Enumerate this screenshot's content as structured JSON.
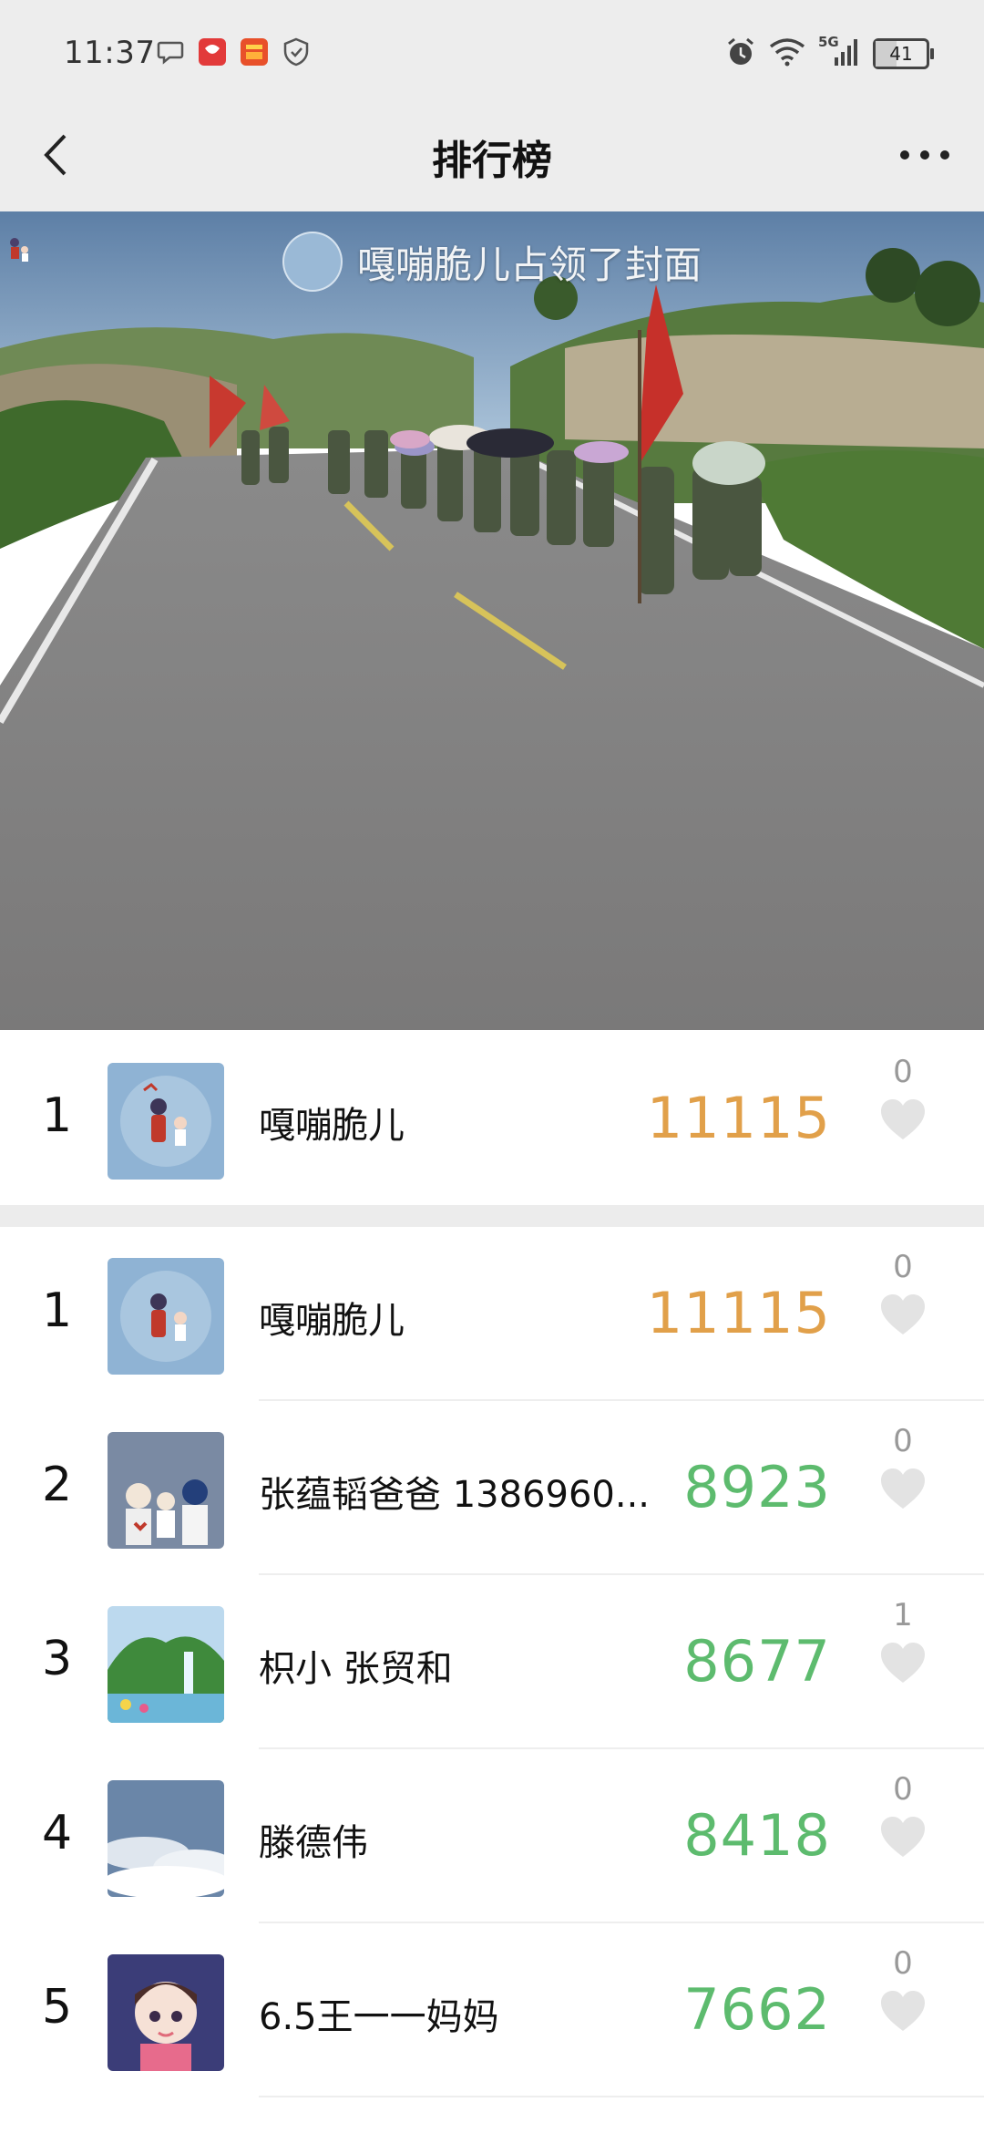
{
  "status_bar": {
    "time": "11:37",
    "battery": "41",
    "battery_level": 0.41,
    "network": "5G",
    "left_icons": [
      "chat-bubble-icon",
      "app-badge-red-icon",
      "app-badge-orange-icon",
      "shield-icon"
    ],
    "right_icons": [
      "alarm-icon",
      "wifi-icon",
      "signal-icon",
      "battery-icon"
    ]
  },
  "nav": {
    "title": "排行榜",
    "back_icon": "chevron-left-icon",
    "more_icon": "more-dots-icon"
  },
  "cover": {
    "banner_text": "嘎嘣脆儿占领了封面",
    "image": "group marching on road with red flags"
  },
  "my_rank": {
    "rank": "1",
    "name": "嘎嘣脆儿",
    "score": "11115",
    "likes": "0"
  },
  "ranking": [
    {
      "rank": "1",
      "name": "嘎嘣脆儿",
      "score": "11115",
      "likes": "0"
    },
    {
      "rank": "2",
      "name": "张蕴韬爸爸 1386960...",
      "score": "8923",
      "likes": "0"
    },
    {
      "rank": "3",
      "name": "枳小  张贸和",
      "score": "8677",
      "likes": "1"
    },
    {
      "rank": "4",
      "name": "滕德伟",
      "score": "8418",
      "likes": "0"
    },
    {
      "rank": "5",
      "name": "6.5王一一妈妈",
      "score": "7662",
      "likes": "0"
    }
  ],
  "colors": {
    "top_score": "#e1a04a",
    "score": "#5dbb6e",
    "heart": "#e3e3e3",
    "header_bg": "#ededed"
  }
}
